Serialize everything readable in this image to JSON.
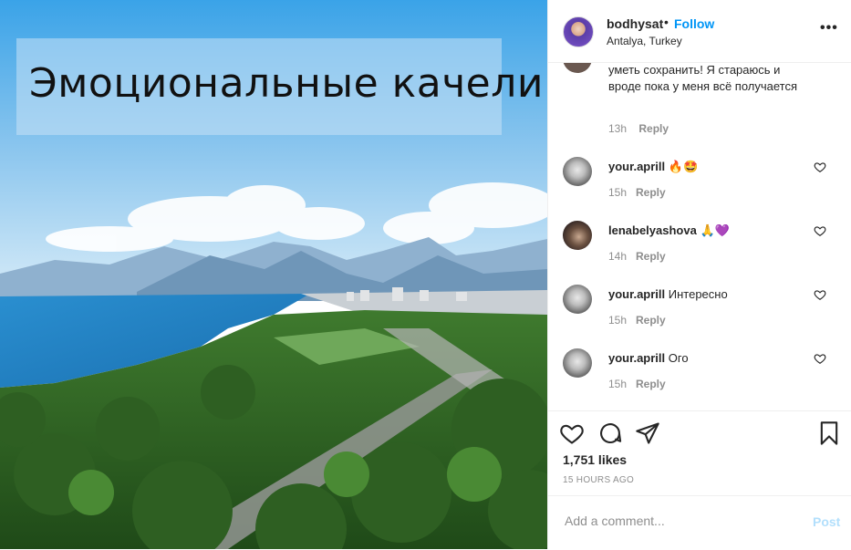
{
  "post": {
    "caption_text": "Эмоциональные качели",
    "image_icon": "landscape-photo"
  },
  "header": {
    "username": "bodhysat",
    "separator": "•",
    "follow_label": "Follow",
    "location": "Antalya, Turkey",
    "more_label": "•••"
  },
  "comments": {
    "partial": {
      "text": "уметь сохранить! Я стараюсь и вроде пока у меня всё получается",
      "time": "13h",
      "reply_label": "Reply"
    },
    "items": [
      {
        "username": "your.aprill",
        "text": "🔥🤩",
        "time": "15h",
        "reply_label": "Reply"
      },
      {
        "username": "lenabelyashova",
        "text": "🙏💜",
        "time": "14h",
        "reply_label": "Reply"
      },
      {
        "username": "your.aprill",
        "text": "Интересно",
        "time": "15h",
        "reply_label": "Reply"
      },
      {
        "username": "your.aprill",
        "text": "Ого",
        "time": "15h",
        "reply_label": "Reply"
      }
    ]
  },
  "actions": {
    "likes": "1,751 likes",
    "posted_ago": "15 HOURS AGO",
    "icons": [
      "heart-icon",
      "comment-icon",
      "share-icon",
      "bookmark-icon"
    ]
  },
  "add_comment": {
    "placeholder": "Add a comment...",
    "post_label": "Post"
  },
  "colors": {
    "link_blue": "#0095f6",
    "post_disabled": "#b2dffc",
    "text": "#262626",
    "muted": "#8e8e8e"
  }
}
